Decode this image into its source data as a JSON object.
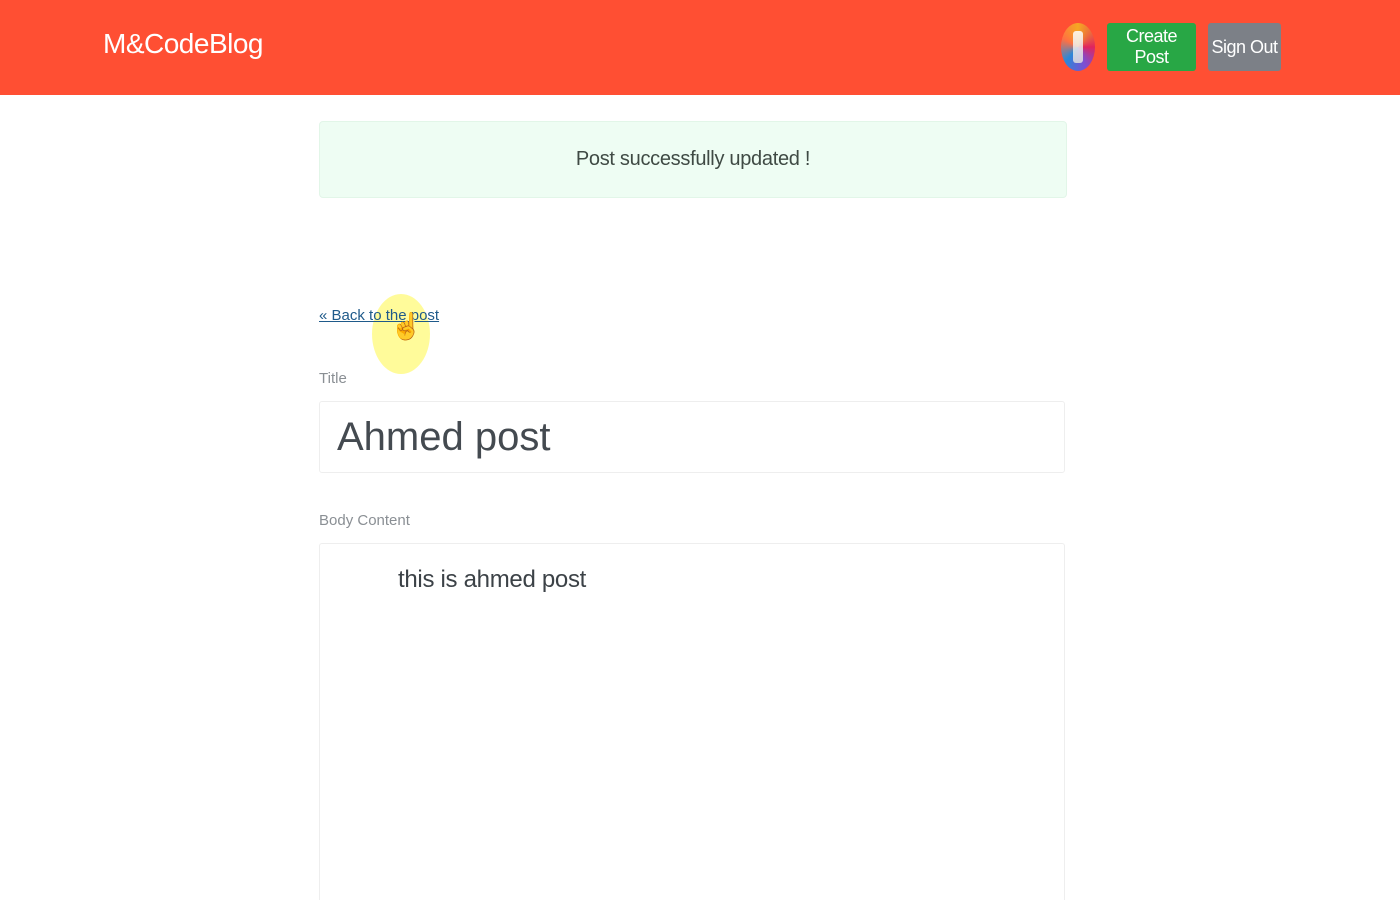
{
  "navbar": {
    "brand": "M&CodeBlog",
    "create_post_label": "Create Post",
    "sign_out_label": "Sign Out",
    "background_color": "#ff4f33",
    "create_color": "#28a745",
    "signout_color": "#7c8087"
  },
  "alert": {
    "message": "Post successfully updated !",
    "background_color": "#eefdf3"
  },
  "form": {
    "back_link": "« Back to the post",
    "title_label": "Title",
    "title_value": "Ahmed post",
    "body_label": "Body Content",
    "body_value": "this is ahmed post"
  },
  "icons": {
    "avatar": "avatar-image",
    "cursor": "hand-pointer-icon"
  }
}
